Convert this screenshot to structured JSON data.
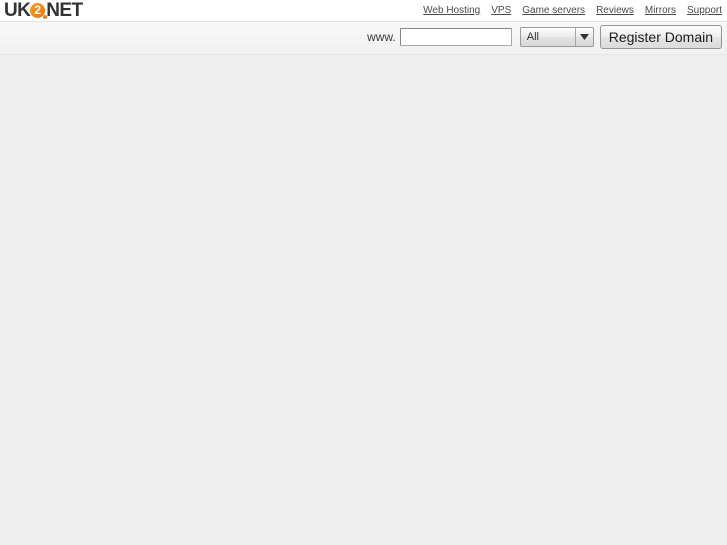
{
  "header": {
    "logo": {
      "text_before": "UK",
      "mark_number": "2",
      "text_after": "NET",
      "accent_color": "#ee7f0a"
    },
    "nav": [
      {
        "label": "Web Hosting"
      },
      {
        "label": "VPS"
      },
      {
        "label": "Game servers"
      },
      {
        "label": "Reviews"
      },
      {
        "label": "Mirrors"
      },
      {
        "label": "Support"
      }
    ]
  },
  "search": {
    "prefix_label": "www.",
    "domain_value": "",
    "domain_placeholder": "",
    "tld_selected": "All",
    "tld_options": [
      "All"
    ],
    "dropdown_icon": "chevron-down-icon",
    "submit_label": "Register Domain"
  },
  "content": {
    "body_text": ""
  }
}
